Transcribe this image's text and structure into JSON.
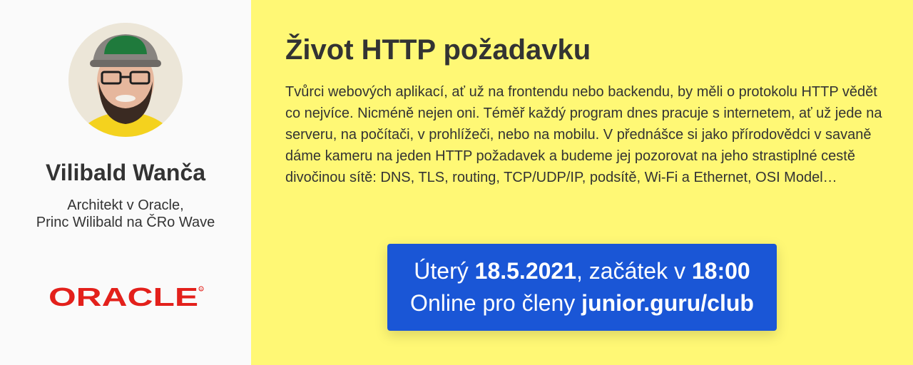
{
  "speaker": {
    "name": "Vilibald Wanča",
    "bio_line_1": "Architekt v Oracle,",
    "bio_line_2": "Princ Wilibald na ČRo Wave",
    "company_logo_text": "ORACLE"
  },
  "talk": {
    "title": "Život HTTP požadavku",
    "abstract": "Tvůrci webových aplikací, ať už na frontendu nebo backendu, by měli o protokolu HTTP vědět co nejvíce. Nicméně nejen oni. Téměř každý program dnes pracuje s internetem, ať už jede na serveru, na počítači, v prohlížeči, nebo na mobilu. V přednášce si jako přírodovědci v savaně dáme kameru na jeden HTTP požadavek a budeme jej pozorovat na jeho strastiplné cestě divočinou sítě: DNS, TLS, routing, TCP/UDP/IP, podsítě, Wi-Fi a Ethernet, OSI Model…"
  },
  "event": {
    "day_prefix": "Úterý ",
    "date": "18.5.2021",
    "start_text": ", začátek v ",
    "time": "18:00",
    "online_text": "Online pro členy ",
    "club_url": "junior.guru/club"
  },
  "colors": {
    "main_background": "#fff875",
    "sidebar_background": "#fafafa",
    "event_box": "#1a56d6",
    "oracle_red": "#e3201b",
    "text": "#333333"
  }
}
